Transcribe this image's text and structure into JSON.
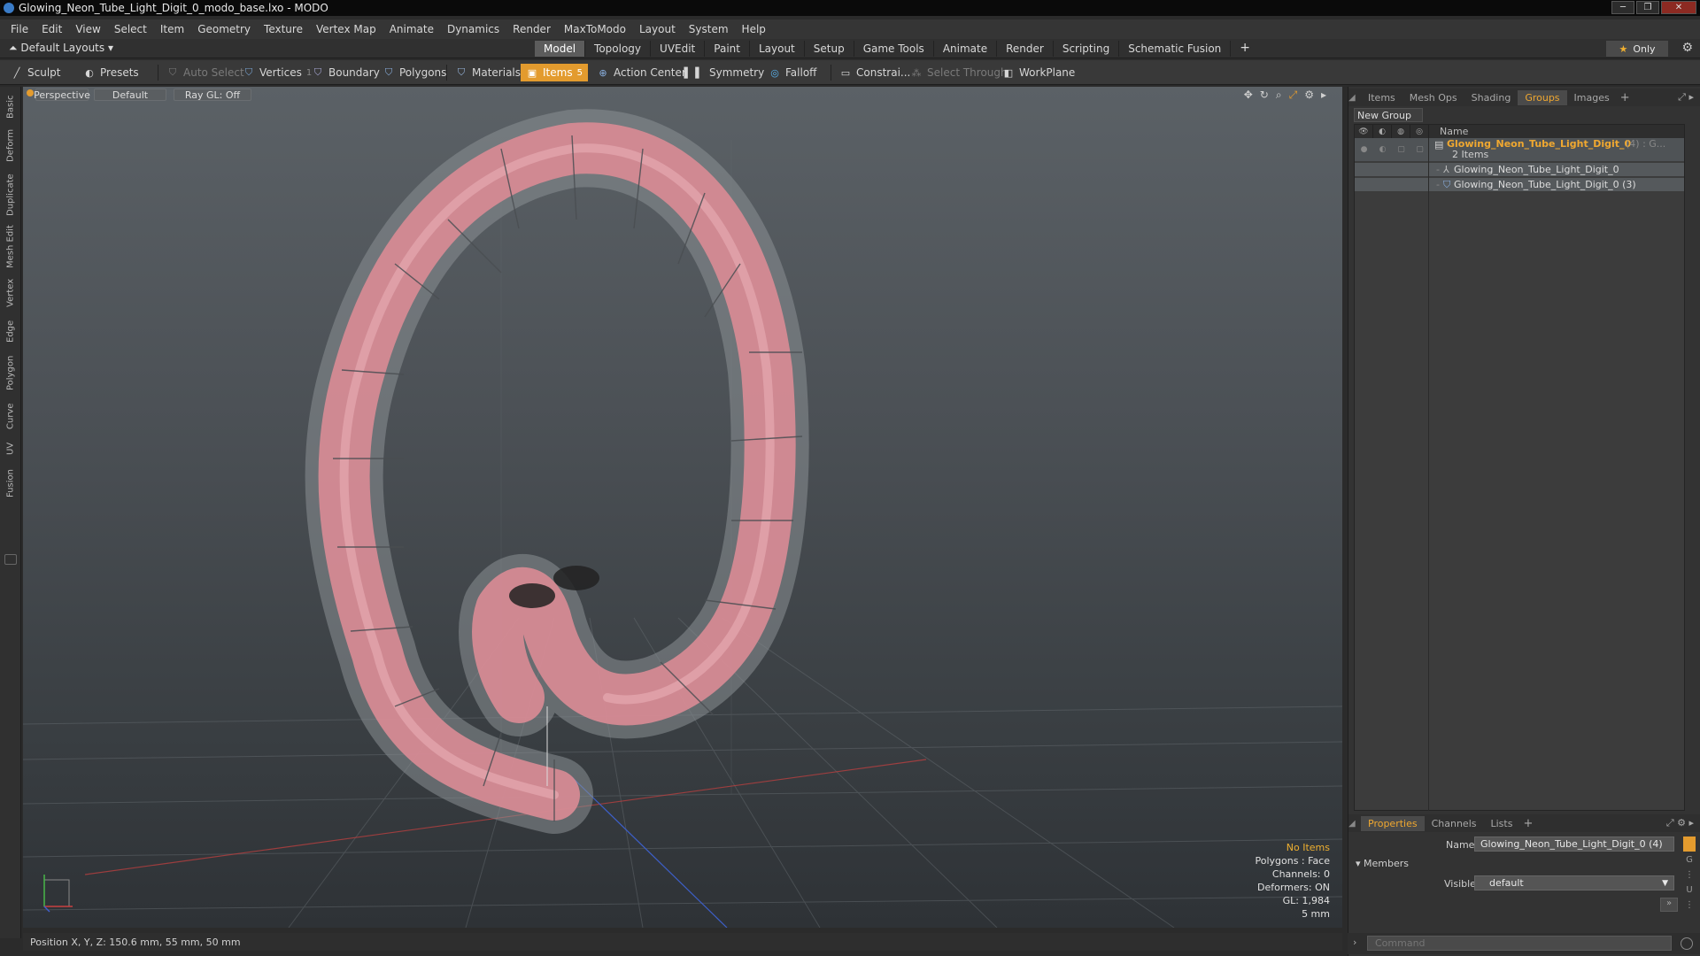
{
  "window": {
    "title": "Glowing_Neon_Tube_Light_Digit_0_modo_base.lxo - MODO"
  },
  "menu": [
    "File",
    "Edit",
    "View",
    "Select",
    "Item",
    "Geometry",
    "Texture",
    "Vertex Map",
    "Animate",
    "Dynamics",
    "Render",
    "MaxToModo",
    "Layout",
    "System",
    "Help"
  ],
  "layout": {
    "preset": "Default Layouts ▾",
    "tabs": [
      "Model",
      "Topology",
      "UVEdit",
      "Paint",
      "Layout",
      "Setup",
      "Game Tools",
      "Animate",
      "Render",
      "Scripting",
      "Schematic Fusion"
    ],
    "active_tab": "Model",
    "only_label": "Only"
  },
  "toolbar": {
    "sculpt": "Sculpt",
    "presets": "Presets",
    "auto_select": "Auto Select",
    "vertices": "Vertices",
    "vertices_count": "1",
    "boundary": "Boundary",
    "polygons": "Polygons",
    "materials": "Materials",
    "items": "Items",
    "items_count": "5",
    "action_center": "Action Center",
    "symmetry": "Symmetry",
    "falloff": "Falloff",
    "constrain": "Constrai...",
    "select_through": "Select Through",
    "workplane": "WorkPlane"
  },
  "left_tabs": [
    "Basic",
    "Deform",
    "Duplicate",
    "Mesh Edit",
    "Vertex",
    "Edge",
    "Polygon",
    "Curve",
    "UV",
    "Fusion"
  ],
  "viewport": {
    "view_mode": "Perspective",
    "shading": "Default",
    "raygl": "Ray GL: Off",
    "stats": {
      "no_items": "No Items",
      "polygons": "Polygons : Face",
      "channels": "Channels: 0",
      "deformers": "Deformers: ON",
      "gl": "GL: 1,984",
      "scale": "5 mm"
    },
    "colors": {
      "tube": "#d88b95",
      "glass": "#8a9093",
      "background_top": "#5b6166",
      "background_bottom": "#2e3236"
    }
  },
  "statusbar": {
    "position": "Position X, Y, Z:  150.6 mm, 55 mm, 50 mm"
  },
  "right_panel": {
    "top_tabs": [
      "Items",
      "Mesh Ops",
      "Shading",
      "Groups",
      "Images"
    ],
    "active_top_tab": "Groups",
    "new_group": "New Group",
    "name_header": "Name",
    "group": {
      "name": "Glowing_Neon_Tube_Light_Digit_0",
      "suffix": "(4) : G...",
      "count": "2 Items",
      "children": [
        "Glowing_Neon_Tube_Light_Digit_0",
        "Glowing_Neon_Tube_Light_Digit_0 (3)"
      ]
    },
    "bottom_tabs": [
      "Properties",
      "Channels",
      "Lists"
    ],
    "active_bottom_tab": "Properties",
    "properties": {
      "name_label": "Name",
      "name_value": "Glowing_Neon_Tube_Light_Digit_0 (4)",
      "members": "Members",
      "visible_label": "Visible",
      "visible_value": "default"
    },
    "command_placeholder": "Command"
  },
  "accent": "#e39b2e"
}
